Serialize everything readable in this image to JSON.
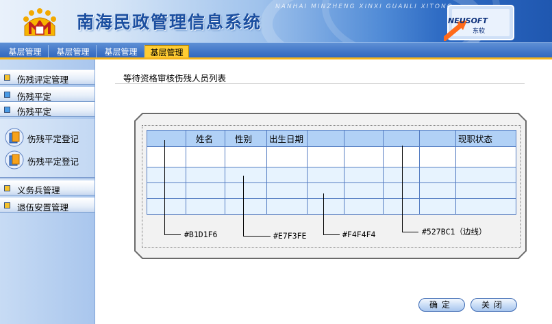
{
  "header": {
    "title": "南海民政管理信息系统",
    "pinyin": "NANHAI MINZHENG XINXI GUANLI XITONG",
    "brand": "NEUSOFT",
    "brand_cn": "东软"
  },
  "nav": {
    "tabs": [
      "基层管理",
      "基层管理",
      "基层管理",
      "基层管理"
    ],
    "active_index": 3
  },
  "sidebar": {
    "groups": [
      {
        "label": "伤残评定管理"
      },
      {
        "label": "伤残平定"
      },
      {
        "label": "伤残平定"
      }
    ],
    "leaves": [
      {
        "label": "伤残平定登记",
        "icon": "book-icon"
      },
      {
        "label": "伤残平定登记",
        "icon": "book-icon"
      }
    ],
    "bottom_groups": [
      {
        "label": "义务兵管理"
      },
      {
        "label": "退伍安置管理"
      }
    ]
  },
  "main": {
    "title": "等待资格审核伤残人员列表",
    "table": {
      "headers": [
        "",
        "姓名",
        "性别",
        "出生日期",
        "",
        "",
        "",
        "",
        "现职状态"
      ],
      "rows": 4
    },
    "annotations": [
      {
        "text": "#B1D1F6"
      },
      {
        "text": "#E7F3FE"
      },
      {
        "text": "#F4F4F4"
      },
      {
        "text": "#527BC1（边线）"
      }
    ]
  },
  "buttons": {
    "confirm": "确定",
    "close": "关闭"
  },
  "colors": {
    "header_bg": "#B1D1F6",
    "row_tint": "#E7F3FE",
    "frame_bg": "#F4F4F4",
    "grid_border": "#527BC1",
    "active_tab": "#FFCC33"
  }
}
